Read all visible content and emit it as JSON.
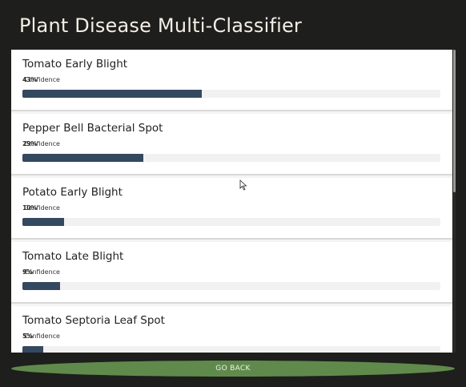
{
  "title": "Plant Disease Multi-Classifier",
  "confidence_label": "Confidence",
  "results": [
    {
      "name": "Tomato Early Blight",
      "confidence": "43%",
      "value": 0.43
    },
    {
      "name": "Pepper Bell Bacterial Spot",
      "confidence": "29%",
      "value": 0.29
    },
    {
      "name": "Potato Early Blight",
      "confidence": "10%",
      "value": 0.1
    },
    {
      "name": "Tomato Late Blight",
      "confidence": "9%",
      "value": 0.09
    },
    {
      "name": "Tomato Septoria Leaf Spot",
      "confidence": "5%",
      "value": 0.05
    }
  ],
  "go_back_label": "GO BACK",
  "colors": {
    "background": "#1e1e1c",
    "bar_fill": "#34485f",
    "button": "#5f8a4c"
  }
}
